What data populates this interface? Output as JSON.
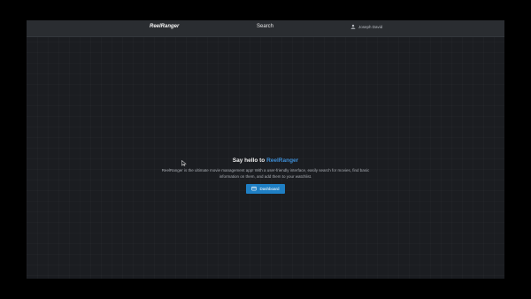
{
  "navbar": {
    "brand": "ReelRanger",
    "search_link": "Search",
    "user_name": "Joseph David",
    "user_icon": "user-avatar-icon"
  },
  "hero": {
    "headline_prefix": "Say hello to ",
    "headline_brand": "ReelRanger",
    "description": "ReelRanger is the ultimate movie management app! With a user-friendly interface, easily search for movies, find basic information on them, and add them to your watchlist.",
    "button_label": "Dashboard",
    "button_icon": "dashboard-icon"
  },
  "colors": {
    "page_background": "#1b1d21",
    "navbar_background": "#2a2d31",
    "accent": "#3d8ed6",
    "button": "#1f7fc4"
  }
}
